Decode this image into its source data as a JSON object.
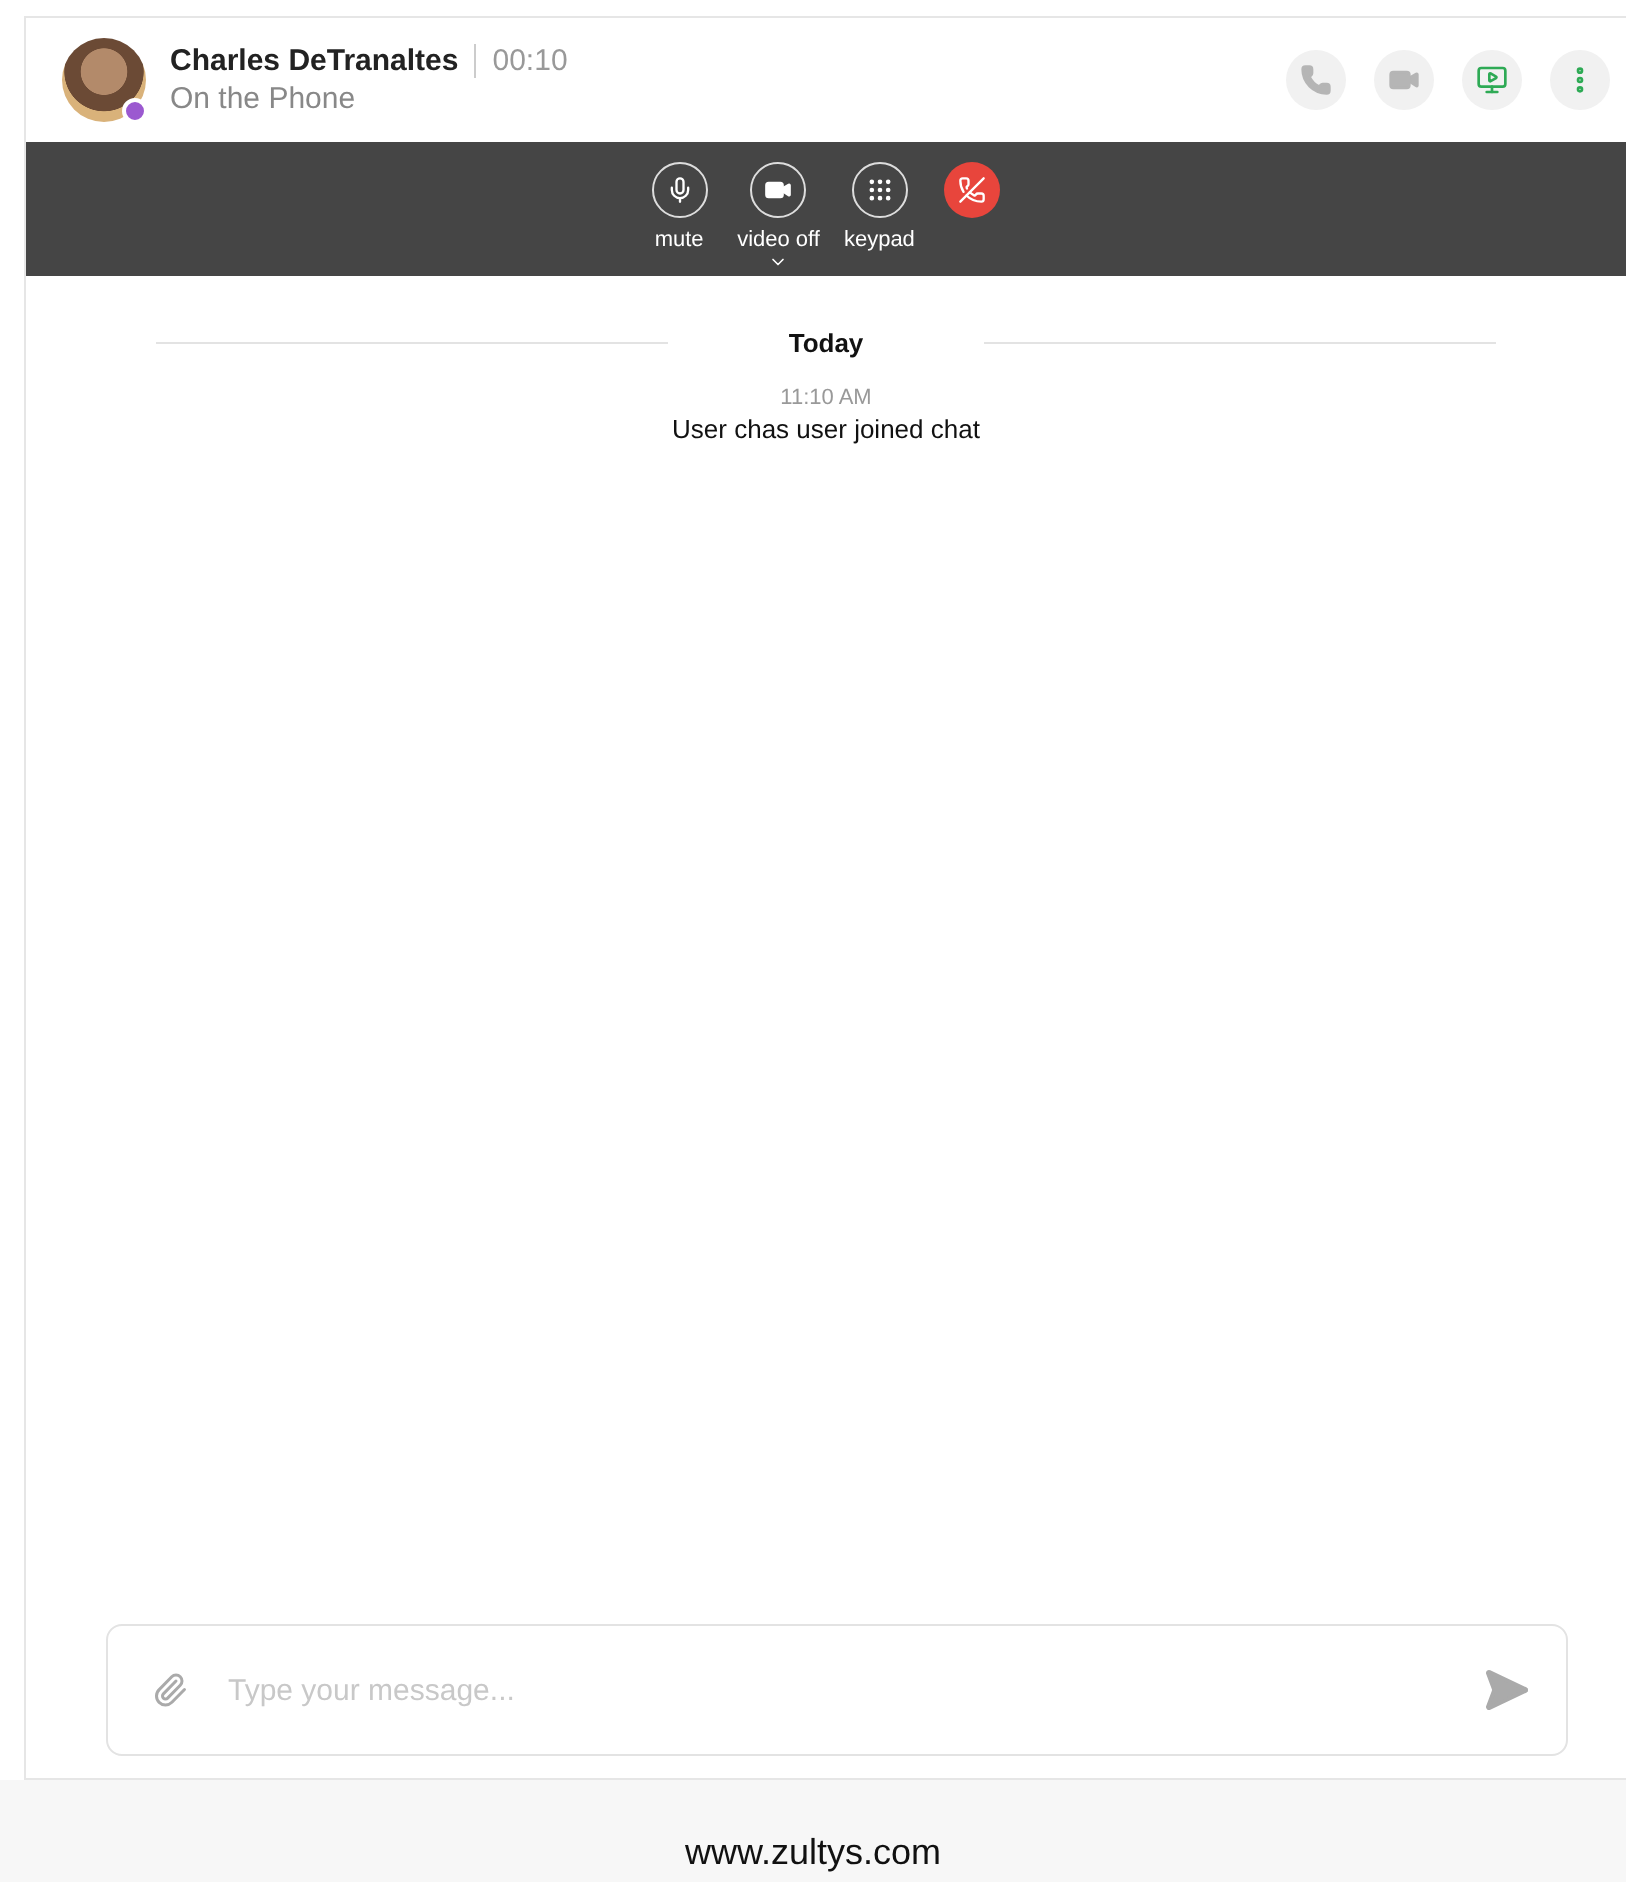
{
  "contact": {
    "name": "Charles DeTranaltes",
    "duration": "00:10",
    "status": "On the Phone"
  },
  "header_actions": [
    {
      "kind": "phone",
      "active": false
    },
    {
      "kind": "video",
      "active": false
    },
    {
      "kind": "screen",
      "active": true
    },
    {
      "kind": "more",
      "active": true
    }
  ],
  "call_controls": [
    {
      "kind": "mute",
      "label": "mute",
      "dropdown": false
    },
    {
      "kind": "video",
      "label": "video off",
      "dropdown": true
    },
    {
      "kind": "keypad",
      "label": "keypad",
      "dropdown": false
    },
    {
      "kind": "hangup",
      "dropdown": false
    }
  ],
  "chat": {
    "date_divider": "Today",
    "messages": [
      {
        "time": "11:10 AM",
        "text": "User chas user joined chat"
      }
    ]
  },
  "composer": {
    "placeholder": "Type your message..."
  },
  "footer": {
    "text": "www.zultys.com"
  }
}
